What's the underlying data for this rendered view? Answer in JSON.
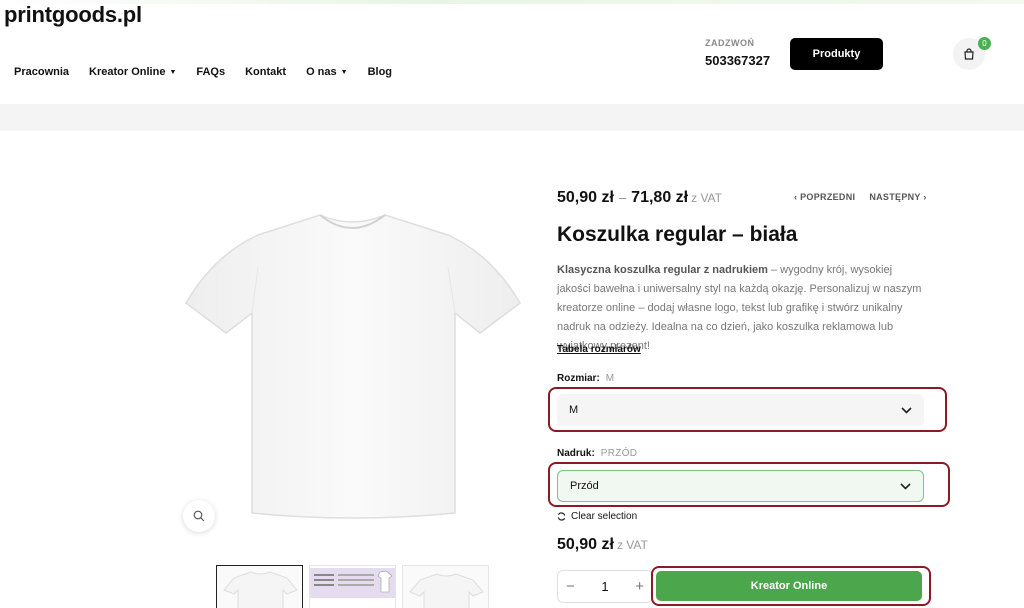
{
  "site": {
    "logo": "printgoods.pl"
  },
  "nav": [
    {
      "label": "Pracownia",
      "has_dropdown": false
    },
    {
      "label": "Kreator Online",
      "has_dropdown": true
    },
    {
      "label": "FAQs",
      "has_dropdown": false
    },
    {
      "label": "Kontakt",
      "has_dropdown": false
    },
    {
      "label": "O nas",
      "has_dropdown": true
    },
    {
      "label": "Blog",
      "has_dropdown": false
    }
  ],
  "contact": {
    "label": "ZADZWOŃ",
    "phone": "503367327"
  },
  "header": {
    "products_button": "Produkty",
    "cart_count": "0"
  },
  "product": {
    "price_min": "50,90 zł",
    "price_sep": "–",
    "price_max": "71,80 zł",
    "vat_label": "z VAT",
    "prev_label": "POPRZEDNI",
    "next_label": "NASTĘPNY",
    "title": "Koszulka regular – biała",
    "desc_bold": "Klasyczna koszulka regular z nadrukiem",
    "desc_rest": " – wygodny krój, wysokiej jakości bawełna i uniwersalny styl na każdą okazję. Personalizuj w naszym kreatorze online – dodaj własne logo, tekst lub grafikę i stwórz unikalny nadruk na odzieży. Idealna na co dzień, jako koszulka reklamowa lub wyjątkowy prezent!",
    "size_table_link": "Tabela rozmiarów",
    "size": {
      "label": "Rozmiar:",
      "value": "M",
      "selected": "M"
    },
    "print": {
      "label": "Nadruk:",
      "value": "PRZÓD",
      "selected": "Przód"
    },
    "clear_label": "Clear selection",
    "current_price": "50,90 zł",
    "quantity": "1",
    "cta": "Kreator Online"
  },
  "colors": {
    "accent_green": "#4ca64c",
    "highlight": "#8b1a24"
  }
}
